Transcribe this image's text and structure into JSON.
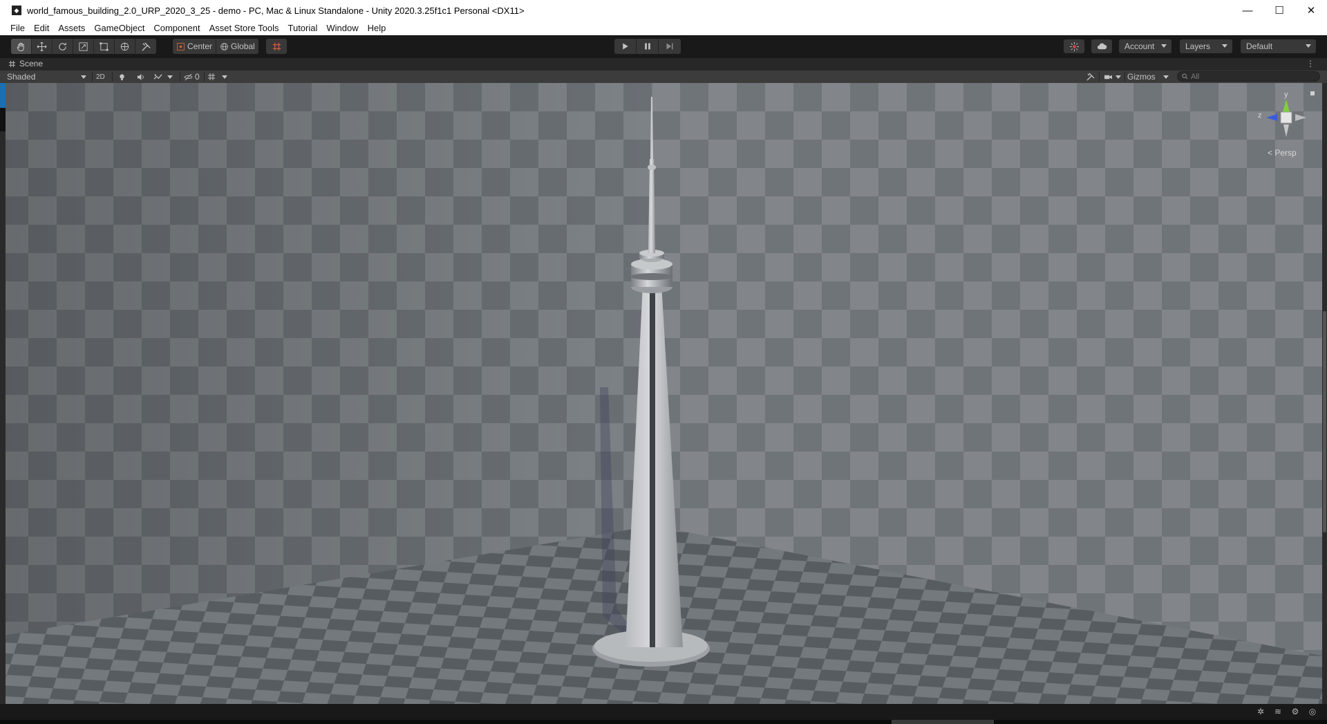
{
  "window": {
    "title": "world_famous_building_2.0_URP_2020_3_25 - demo - PC, Mac & Linux Standalone - Unity 2020.3.25f1c1 Personal <DX11>",
    "controls": {
      "minimize": "—",
      "maximize": "☐",
      "close": "✕"
    }
  },
  "menu": {
    "items": [
      "File",
      "Edit",
      "Assets",
      "GameObject",
      "Component",
      "Asset Store Tools",
      "Tutorial",
      "Window",
      "Help"
    ]
  },
  "toolbar": {
    "tools": [
      "hand-tool",
      "move-tool",
      "rotate-tool",
      "scale-tool",
      "rect-tool",
      "transform-tool",
      "custom-tool"
    ],
    "active_tool": "hand-tool",
    "pivot_label": "Center",
    "space_label": "Global",
    "account_label": "Account",
    "layers_label": "Layers",
    "layout_label": "Default"
  },
  "scene": {
    "tab_label": "Scene",
    "draw_mode": "Shaded",
    "mode_2d_label": "2D",
    "hidden_count": "0",
    "gizmos_label": "Gizmos",
    "search_placeholder": "All",
    "gizmo_y_label": "y",
    "gizmo_z_label": "z",
    "projection_label": "< Persp"
  },
  "colors": {
    "unity_dark": "#191919",
    "panel": "#383838",
    "gizmo_y": "#7fd13b",
    "gizmo_z": "#3a5bd9",
    "gizmo_x": "#d8d8d8"
  }
}
